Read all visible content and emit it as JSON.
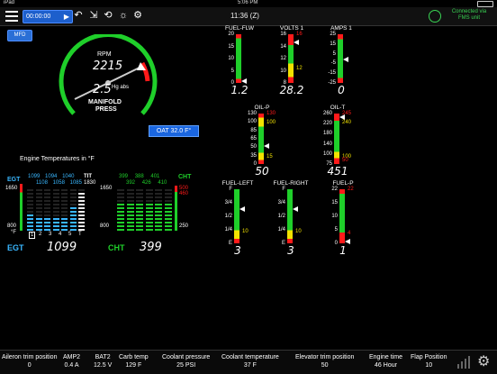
{
  "status_bar": {
    "device": "iPad",
    "time": "5:06 PM"
  },
  "toolbar": {
    "timer_value": "00:00:00",
    "clock": "11:36 (Z)",
    "connection_line1": "Connected via",
    "connection_line2": "FMS unit"
  },
  "mfd_label": "MFD",
  "rpm_gauge": {
    "label": "RPM",
    "rpm_value": "2215",
    "mp_value": "2.5",
    "mp_unit": "Hg abs",
    "mp_label1": "MANIFOLD",
    "mp_label2": "PRESS"
  },
  "oat": "OAT 32.0 F°",
  "engine_temps": {
    "title": "Engine Temperatures in °F",
    "egt_label": "EGT",
    "egt_top": "1650",
    "egt_bottom": "800",
    "f_label": "°F",
    "egt_values_row1": [
      "1099",
      "1094",
      "1040"
    ],
    "egt_values_row2": [
      "1108",
      "1058",
      "1085"
    ],
    "tit_label": "TIT",
    "tit_value": "1830",
    "tit_scale_top": "1650",
    "tit_scale_bottom": "800",
    "cylinders": [
      "1",
      "2",
      "3",
      "4",
      "5",
      "T"
    ],
    "egt_readout": "1099",
    "cht_label": "CHT",
    "cht_values_row1": [
      "399",
      "388",
      "401"
    ],
    "cht_values_row2": [
      "392",
      "426",
      "410"
    ],
    "cht_top1": "500",
    "cht_top2": "460",
    "cht_bottom": "250",
    "cht_readout": "399"
  },
  "gauges": {
    "fuel_flw": {
      "title": "FUEL-FLW",
      "ticks": [
        "20",
        "15",
        "10",
        "5",
        "0"
      ],
      "value": "1.2"
    },
    "volts": {
      "title": "VOLTS 1",
      "ticks": [
        "16",
        "14",
        "12",
        "10",
        "8"
      ],
      "mark": "16",
      "mark2": "12",
      "value": "28.2"
    },
    "amps": {
      "title": "AMPS 1",
      "ticks": [
        "25",
        "15",
        "5",
        "-5",
        "-15",
        "-25"
      ],
      "value": "0"
    },
    "oil_p": {
      "title": "OIL-P",
      "ticks": [
        "130",
        "100",
        "85",
        "65",
        "50",
        "35",
        "0"
      ],
      "mark_hi": "130",
      "mark_mid": "100",
      "mark_lo": "15",
      "value": "50"
    },
    "oil_t": {
      "title": "OIL-T",
      "ticks": [
        "260",
        "220",
        "180",
        "140",
        "100",
        "75"
      ],
      "mark_hi": "245",
      "mark_mid": "240",
      "mark_lo": "100",
      "mark_lo2": "50",
      "value": "451"
    },
    "fuel_left": {
      "title": "FUEL-LEFT",
      "ticks": [
        "F",
        "3/4",
        "1/2",
        "1/4",
        "E"
      ],
      "mark": "10",
      "value": "3"
    },
    "fuel_right": {
      "title": "FUEL-RIGHT",
      "ticks": [
        "F",
        "3/4",
        "1/2",
        "1/4",
        "E"
      ],
      "mark": "10",
      "value": "3"
    },
    "fuel_p": {
      "title": "FUEL-P",
      "ticks": [
        "22",
        "15",
        "10",
        "5",
        "0"
      ],
      "mark_hi": "22",
      "mark_lo": "4",
      "value": "1"
    }
  },
  "bottom_bar": [
    {
      "label": "Aileron trim position",
      "value": "0"
    },
    {
      "label": "AMP2",
      "value": "0.4 A"
    },
    {
      "label": "BAT2",
      "value": "12.5 V"
    },
    {
      "label": "Carb temp",
      "value": "129 F"
    },
    {
      "label": "Coolant pressure",
      "value": "25 PSI"
    },
    {
      "label": "Coolant temperature",
      "value": "37 F"
    },
    {
      "label": "Elevator trim position",
      "value": "50"
    },
    {
      "label": "Engine time",
      "value": "46 Hour"
    },
    {
      "label": "Flap Position",
      "value": "10"
    }
  ],
  "colors": {
    "green": "#1fcf2a",
    "yellow": "#f2e200",
    "red": "#ff1a1a",
    "blue": "#2f7dff",
    "cyan": "#39b7ff"
  }
}
